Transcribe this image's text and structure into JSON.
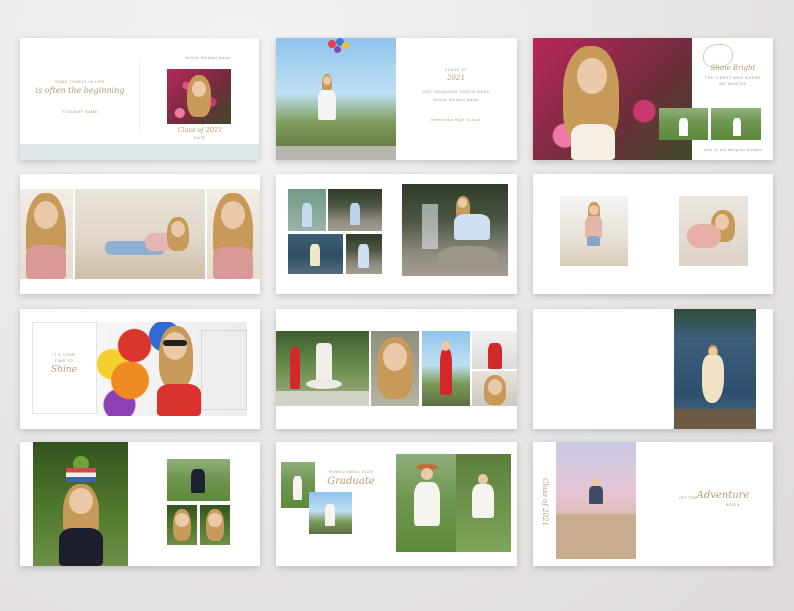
{
  "pages": {
    "p1": {
      "intro": "SOME THINGS IN LIFE",
      "script": "is often the beginning",
      "small_caps": "STUDENT NAME",
      "name": "Senior Student Name",
      "class_script": "Class of 2021",
      "bottom": "DATE"
    },
    "p2": {
      "class_label": "CLASS OF",
      "year": "2021",
      "line1": "2021 GRADUATE PHOTO BOOK",
      "line2": "Senior Student Name",
      "line3": "Hometown High School"
    },
    "p3": {
      "script": "Shine Bright",
      "line1": "THE FINEST WAS WHERE",
      "line2": "WE WANTED",
      "line3": "sink to the deepest dreams"
    },
    "p7": {
      "small1": "IT'S YOUR",
      "small2": "TIME TO",
      "script": "Shine"
    },
    "p11": {
      "small1": "HOMECOMING HIGH",
      "script": "Graduate"
    },
    "p12": {
      "vertical": "Class of 2021",
      "small1": "LET THE",
      "script": "Adventure",
      "small2": "BEGIN"
    }
  },
  "colors": {
    "accent": "#b99b6e",
    "background": "#eceaea",
    "card": "#ffffff",
    "band": "#dde5ea"
  }
}
